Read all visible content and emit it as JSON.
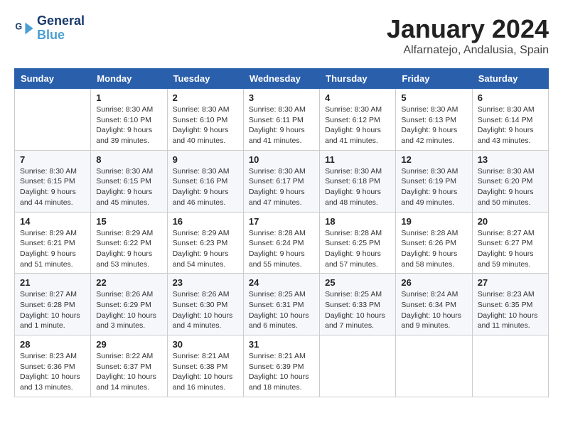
{
  "logo": {
    "line1": "General",
    "line2": "Blue"
  },
  "title": "January 2024",
  "subtitle": "Alfarnatejo, Andalusia, Spain",
  "weekdays": [
    "Sunday",
    "Monday",
    "Tuesday",
    "Wednesday",
    "Thursday",
    "Friday",
    "Saturday"
  ],
  "weeks": [
    [
      {
        "day": "",
        "info": ""
      },
      {
        "day": "1",
        "info": "Sunrise: 8:30 AM\nSunset: 6:10 PM\nDaylight: 9 hours and 39 minutes."
      },
      {
        "day": "2",
        "info": "Sunrise: 8:30 AM\nSunset: 6:10 PM\nDaylight: 9 hours and 40 minutes."
      },
      {
        "day": "3",
        "info": "Sunrise: 8:30 AM\nSunset: 6:11 PM\nDaylight: 9 hours and 41 minutes."
      },
      {
        "day": "4",
        "info": "Sunrise: 8:30 AM\nSunset: 6:12 PM\nDaylight: 9 hours and 41 minutes."
      },
      {
        "day": "5",
        "info": "Sunrise: 8:30 AM\nSunset: 6:13 PM\nDaylight: 9 hours and 42 minutes."
      },
      {
        "day": "6",
        "info": "Sunrise: 8:30 AM\nSunset: 6:14 PM\nDaylight: 9 hours and 43 minutes."
      }
    ],
    [
      {
        "day": "7",
        "info": "Sunrise: 8:30 AM\nSunset: 6:15 PM\nDaylight: 9 hours and 44 minutes."
      },
      {
        "day": "8",
        "info": "Sunrise: 8:30 AM\nSunset: 6:15 PM\nDaylight: 9 hours and 45 minutes."
      },
      {
        "day": "9",
        "info": "Sunrise: 8:30 AM\nSunset: 6:16 PM\nDaylight: 9 hours and 46 minutes."
      },
      {
        "day": "10",
        "info": "Sunrise: 8:30 AM\nSunset: 6:17 PM\nDaylight: 9 hours and 47 minutes."
      },
      {
        "day": "11",
        "info": "Sunrise: 8:30 AM\nSunset: 6:18 PM\nDaylight: 9 hours and 48 minutes."
      },
      {
        "day": "12",
        "info": "Sunrise: 8:30 AM\nSunset: 6:19 PM\nDaylight: 9 hours and 49 minutes."
      },
      {
        "day": "13",
        "info": "Sunrise: 8:30 AM\nSunset: 6:20 PM\nDaylight: 9 hours and 50 minutes."
      }
    ],
    [
      {
        "day": "14",
        "info": "Sunrise: 8:29 AM\nSunset: 6:21 PM\nDaylight: 9 hours and 51 minutes."
      },
      {
        "day": "15",
        "info": "Sunrise: 8:29 AM\nSunset: 6:22 PM\nDaylight: 9 hours and 53 minutes."
      },
      {
        "day": "16",
        "info": "Sunrise: 8:29 AM\nSunset: 6:23 PM\nDaylight: 9 hours and 54 minutes."
      },
      {
        "day": "17",
        "info": "Sunrise: 8:28 AM\nSunset: 6:24 PM\nDaylight: 9 hours and 55 minutes."
      },
      {
        "day": "18",
        "info": "Sunrise: 8:28 AM\nSunset: 6:25 PM\nDaylight: 9 hours and 57 minutes."
      },
      {
        "day": "19",
        "info": "Sunrise: 8:28 AM\nSunset: 6:26 PM\nDaylight: 9 hours and 58 minutes."
      },
      {
        "day": "20",
        "info": "Sunrise: 8:27 AM\nSunset: 6:27 PM\nDaylight: 9 hours and 59 minutes."
      }
    ],
    [
      {
        "day": "21",
        "info": "Sunrise: 8:27 AM\nSunset: 6:28 PM\nDaylight: 10 hours and 1 minute."
      },
      {
        "day": "22",
        "info": "Sunrise: 8:26 AM\nSunset: 6:29 PM\nDaylight: 10 hours and 3 minutes."
      },
      {
        "day": "23",
        "info": "Sunrise: 8:26 AM\nSunset: 6:30 PM\nDaylight: 10 hours and 4 minutes."
      },
      {
        "day": "24",
        "info": "Sunrise: 8:25 AM\nSunset: 6:31 PM\nDaylight: 10 hours and 6 minutes."
      },
      {
        "day": "25",
        "info": "Sunrise: 8:25 AM\nSunset: 6:33 PM\nDaylight: 10 hours and 7 minutes."
      },
      {
        "day": "26",
        "info": "Sunrise: 8:24 AM\nSunset: 6:34 PM\nDaylight: 10 hours and 9 minutes."
      },
      {
        "day": "27",
        "info": "Sunrise: 8:23 AM\nSunset: 6:35 PM\nDaylight: 10 hours and 11 minutes."
      }
    ],
    [
      {
        "day": "28",
        "info": "Sunrise: 8:23 AM\nSunset: 6:36 PM\nDaylight: 10 hours and 13 minutes."
      },
      {
        "day": "29",
        "info": "Sunrise: 8:22 AM\nSunset: 6:37 PM\nDaylight: 10 hours and 14 minutes."
      },
      {
        "day": "30",
        "info": "Sunrise: 8:21 AM\nSunset: 6:38 PM\nDaylight: 10 hours and 16 minutes."
      },
      {
        "day": "31",
        "info": "Sunrise: 8:21 AM\nSunset: 6:39 PM\nDaylight: 10 hours and 18 minutes."
      },
      {
        "day": "",
        "info": ""
      },
      {
        "day": "",
        "info": ""
      },
      {
        "day": "",
        "info": ""
      }
    ]
  ]
}
